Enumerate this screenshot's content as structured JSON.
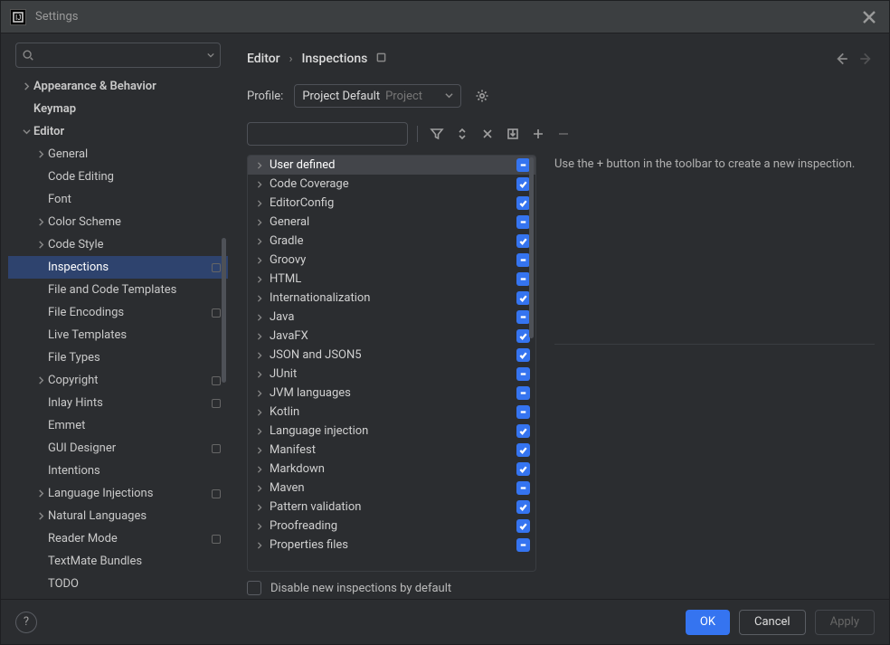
{
  "window": {
    "title": "Settings"
  },
  "breadcrumb": {
    "root": "Editor",
    "leaf": "Inspections"
  },
  "sidebar": {
    "items": [
      {
        "label": "Appearance & Behavior",
        "depth": 0,
        "expandable": true,
        "expanded": false,
        "bold": true
      },
      {
        "label": "Keymap",
        "depth": 0,
        "expandable": false,
        "bold": true
      },
      {
        "label": "Editor",
        "depth": 0,
        "expandable": true,
        "expanded": true,
        "bold": true
      },
      {
        "label": "General",
        "depth": 1,
        "expandable": true,
        "expanded": false
      },
      {
        "label": "Code Editing",
        "depth": 1,
        "expandable": false
      },
      {
        "label": "Font",
        "depth": 1,
        "expandable": false
      },
      {
        "label": "Color Scheme",
        "depth": 1,
        "expandable": true,
        "expanded": false
      },
      {
        "label": "Code Style",
        "depth": 1,
        "expandable": true,
        "expanded": false
      },
      {
        "label": "Inspections",
        "depth": 1,
        "expandable": false,
        "selected": true,
        "badge": true
      },
      {
        "label": "File and Code Templates",
        "depth": 1,
        "expandable": false
      },
      {
        "label": "File Encodings",
        "depth": 1,
        "expandable": false,
        "badge": true
      },
      {
        "label": "Live Templates",
        "depth": 1,
        "expandable": false
      },
      {
        "label": "File Types",
        "depth": 1,
        "expandable": false
      },
      {
        "label": "Copyright",
        "depth": 1,
        "expandable": true,
        "expanded": false,
        "badge": true
      },
      {
        "label": "Inlay Hints",
        "depth": 1,
        "expandable": false,
        "badge": true
      },
      {
        "label": "Emmet",
        "depth": 1,
        "expandable": false
      },
      {
        "label": "GUI Designer",
        "depth": 1,
        "expandable": false,
        "badge": true
      },
      {
        "label": "Intentions",
        "depth": 1,
        "expandable": false
      },
      {
        "label": "Language Injections",
        "depth": 1,
        "expandable": true,
        "expanded": false,
        "badge": true
      },
      {
        "label": "Natural Languages",
        "depth": 1,
        "expandable": true,
        "expanded": false
      },
      {
        "label": "Reader Mode",
        "depth": 1,
        "expandable": false,
        "badge": true
      },
      {
        "label": "TextMate Bundles",
        "depth": 1,
        "expandable": false
      },
      {
        "label": "TODO",
        "depth": 1,
        "expandable": false
      }
    ]
  },
  "profile": {
    "label": "Profile:",
    "value": "Project Default",
    "hint": "Project"
  },
  "inspections": {
    "items": [
      {
        "label": "User defined",
        "state": "partial",
        "selected": true
      },
      {
        "label": "Code Coverage",
        "state": "full"
      },
      {
        "label": "EditorConfig",
        "state": "full"
      },
      {
        "label": "General",
        "state": "partial"
      },
      {
        "label": "Gradle",
        "state": "full"
      },
      {
        "label": "Groovy",
        "state": "partial"
      },
      {
        "label": "HTML",
        "state": "partial"
      },
      {
        "label": "Internationalization",
        "state": "full"
      },
      {
        "label": "Java",
        "state": "partial"
      },
      {
        "label": "JavaFX",
        "state": "full"
      },
      {
        "label": "JSON and JSON5",
        "state": "full"
      },
      {
        "label": "JUnit",
        "state": "partial"
      },
      {
        "label": "JVM languages",
        "state": "partial"
      },
      {
        "label": "Kotlin",
        "state": "partial"
      },
      {
        "label": "Language injection",
        "state": "full"
      },
      {
        "label": "Manifest",
        "state": "full"
      },
      {
        "label": "Markdown",
        "state": "full"
      },
      {
        "label": "Maven",
        "state": "partial"
      },
      {
        "label": "Pattern validation",
        "state": "full"
      },
      {
        "label": "Proofreading",
        "state": "full"
      },
      {
        "label": "Properties files",
        "state": "partial"
      }
    ]
  },
  "detail": {
    "text": "Use the + button in the toolbar to create a new inspection."
  },
  "disable_label": "Disable new inspections by default",
  "footer": {
    "ok": "OK",
    "cancel": "Cancel",
    "apply": "Apply"
  }
}
